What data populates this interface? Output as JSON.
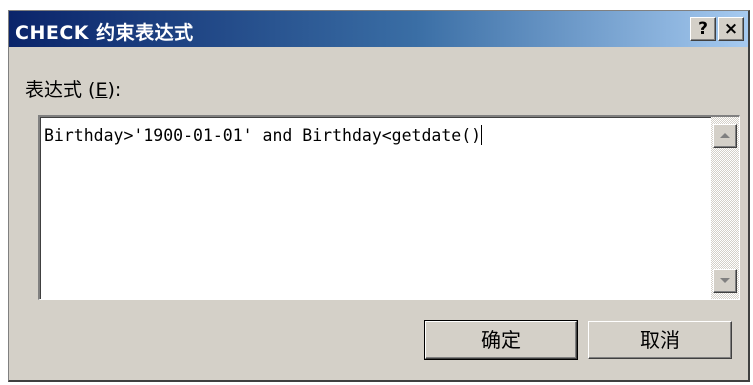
{
  "dialog": {
    "title": "CHECK 约束表达式",
    "help_button": "?",
    "close_button": "×"
  },
  "expression": {
    "label_prefix": "表达式 (",
    "label_accel": "E",
    "label_suffix": "):",
    "value": "Birthday>'1900-01-01' and Birthday<getdate()"
  },
  "buttons": {
    "ok_label": "确定",
    "cancel_label": "取消"
  },
  "colors": {
    "title_gradient_start": "#0a246a",
    "title_gradient_end": "#a6caf0",
    "dialog_face": "#d4d0c8"
  }
}
